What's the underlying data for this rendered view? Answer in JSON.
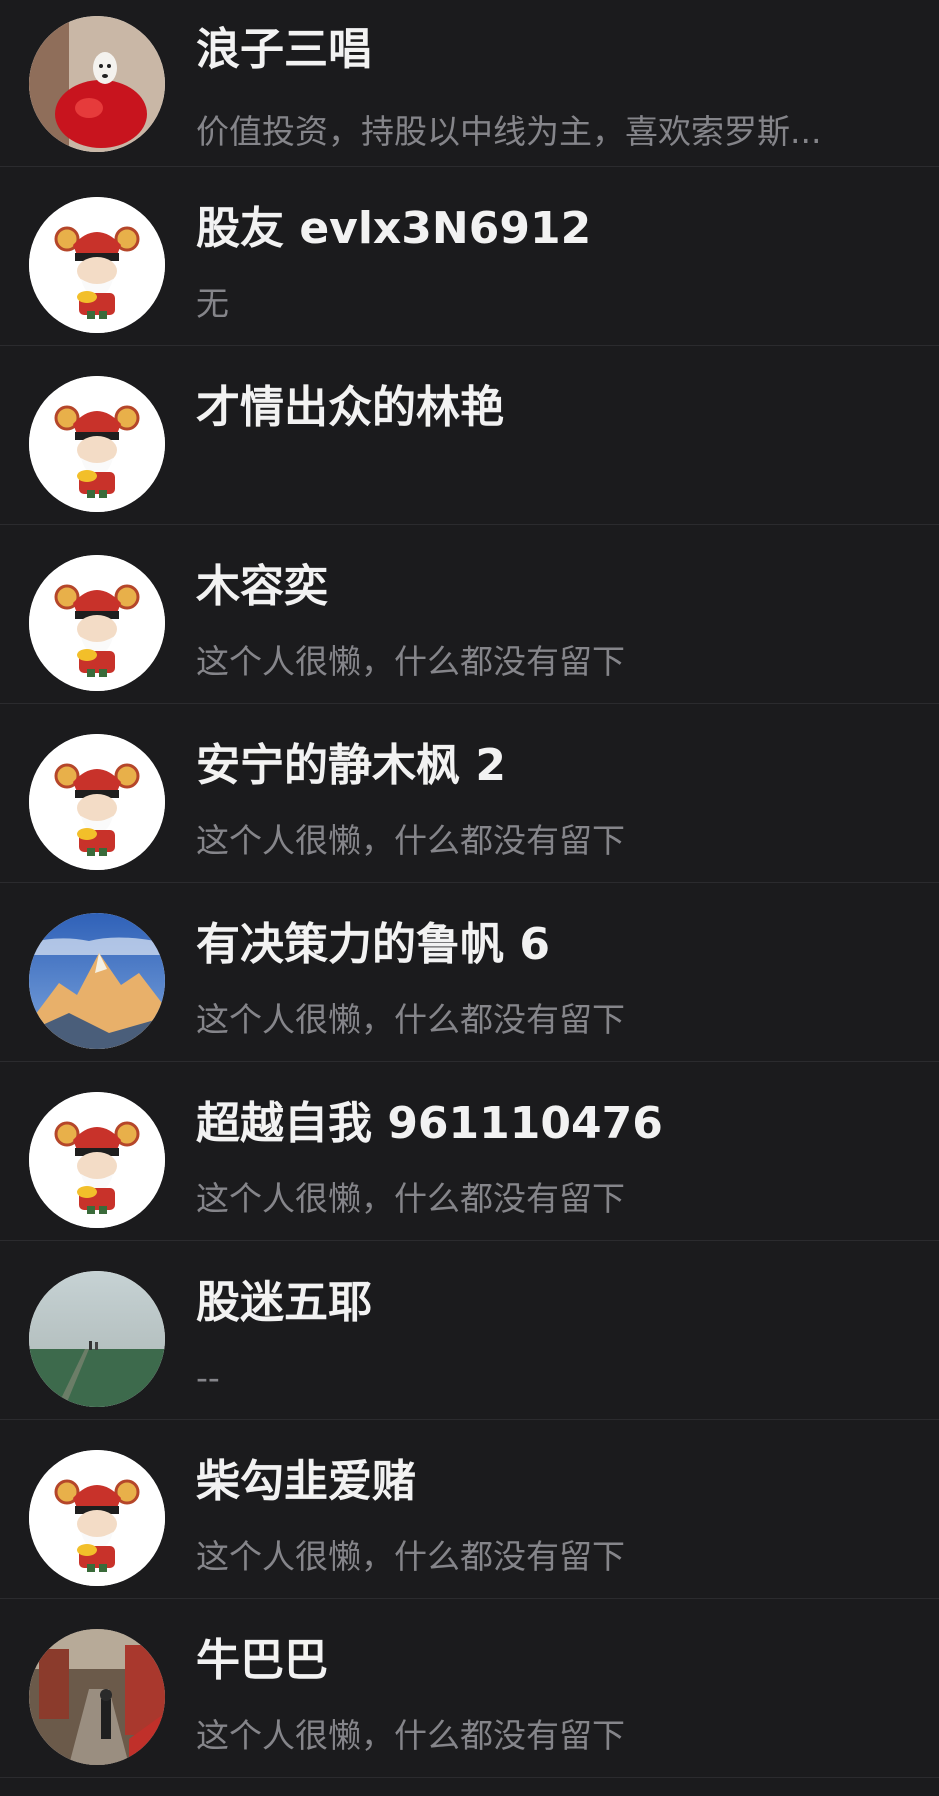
{
  "users": [
    {
      "name": "浪子三唱",
      "desc": "价值投资，持股以中线为主，喜欢索罗斯...",
      "avatar": "dog-photo-avatar"
    },
    {
      "name": "股友 evlx3N6912",
      "desc": "无",
      "avatar": "fortune-god-avatar"
    },
    {
      "name": "才情出众的林艳",
      "desc": "",
      "avatar": "fortune-god-avatar"
    },
    {
      "name": "木容奕",
      "desc": "这个人很懒，什么都没有留下",
      "avatar": "fortune-god-avatar"
    },
    {
      "name": "安宁的静木枫 2",
      "desc": "这个人很懒，什么都没有留下",
      "avatar": "fortune-god-avatar"
    },
    {
      "name": "有决策力的鲁帆 6",
      "desc": "这个人很懒，什么都没有留下",
      "avatar": "mountain-photo-avatar"
    },
    {
      "name": "超越自我 961110476",
      "desc": "这个人很懒，什么都没有留下",
      "avatar": "fortune-god-avatar"
    },
    {
      "name": "股迷五耶",
      "desc": "--",
      "avatar": "field-photo-avatar"
    },
    {
      "name": "柴勾韭爱赌",
      "desc": "这个人很懒，什么都没有留下",
      "avatar": "fortune-god-avatar"
    },
    {
      "name": "牛巴巴",
      "desc": "这个人很懒，什么都没有留下",
      "avatar": "street-photo-avatar"
    }
  ]
}
